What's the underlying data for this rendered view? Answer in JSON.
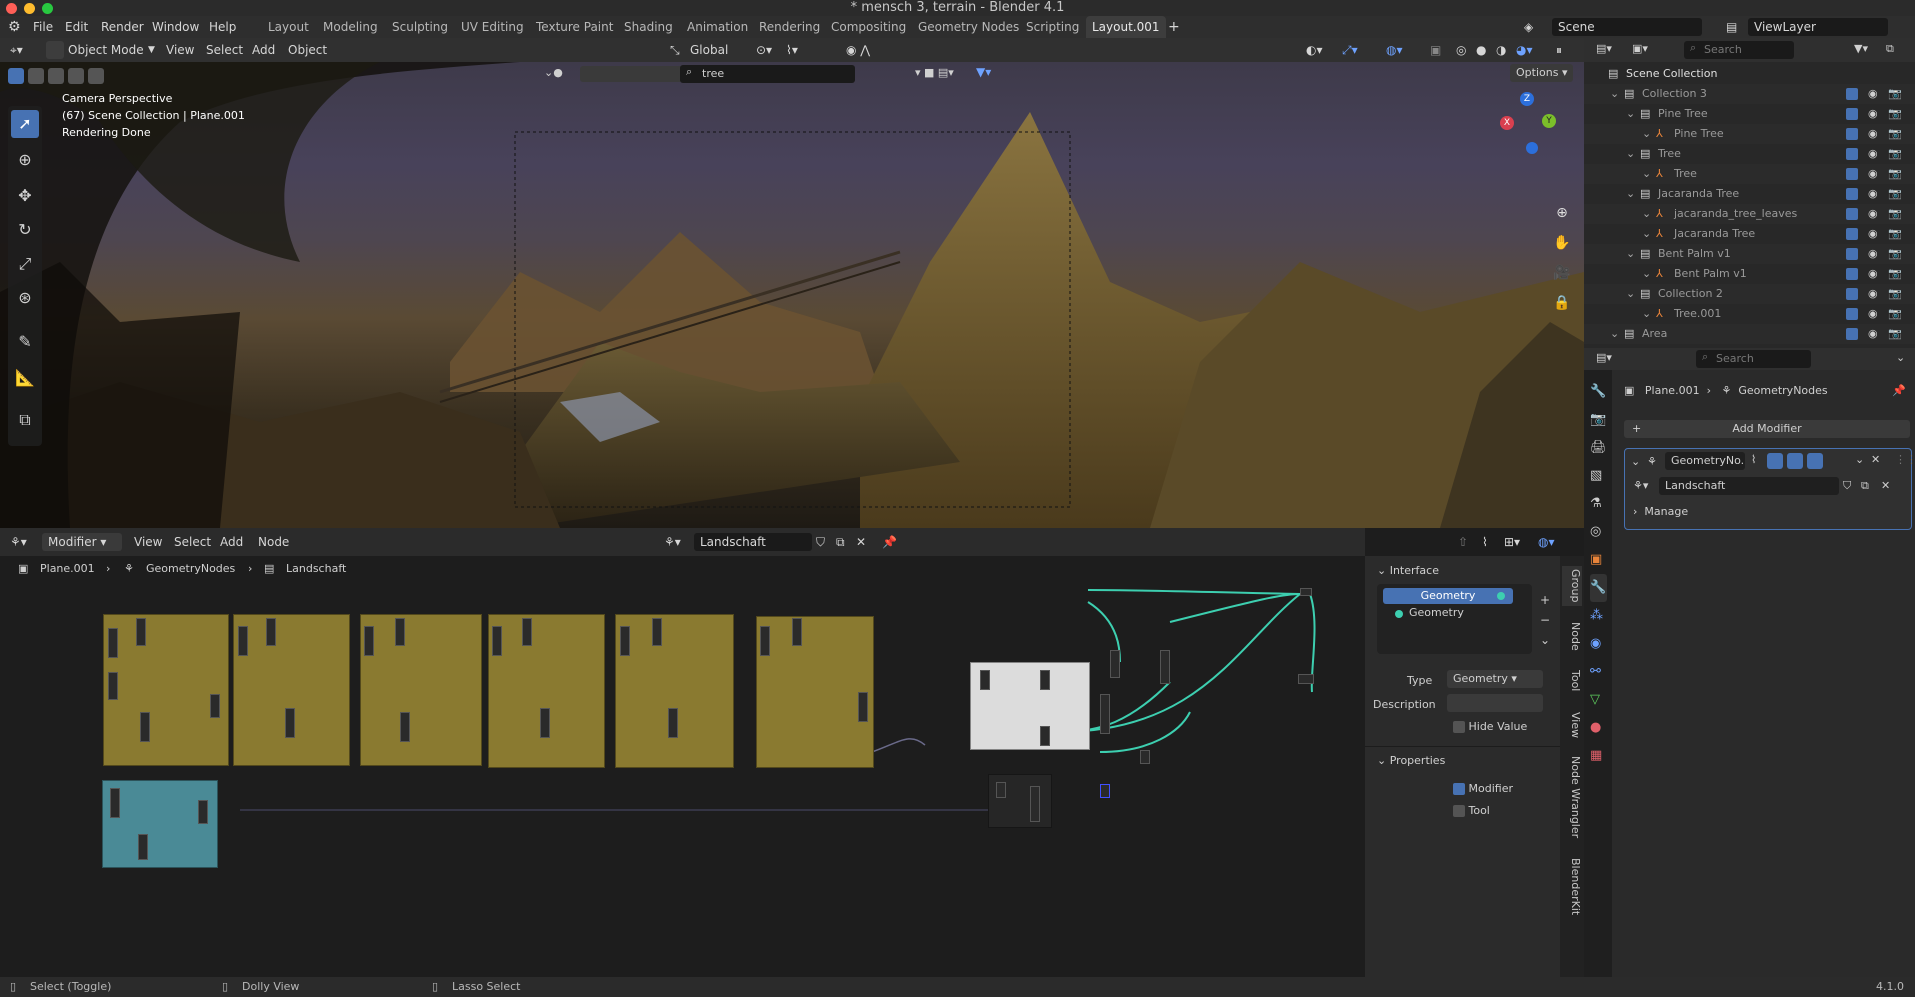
{
  "window": {
    "title": "* mensch 3, terrain - Blender 4.1"
  },
  "menu": {
    "file": "File",
    "edit": "Edit",
    "render": "Render",
    "window": "Window",
    "help": "Help"
  },
  "workspaces": [
    "Layout",
    "Modeling",
    "Sculpting",
    "UV Editing",
    "Texture Paint",
    "Shading",
    "Animation",
    "Rendering",
    "Compositing",
    "Geometry Nodes",
    "Scripting",
    "Layout.001"
  ],
  "scene": {
    "label": "Scene",
    "viewlayer": "ViewLayer"
  },
  "viewport_header": {
    "mode": "Object Mode",
    "view": "View",
    "select": "Select",
    "add": "Add",
    "object": "Object",
    "transform": "Global",
    "search_value": "tree",
    "options": "Options"
  },
  "viewport_overlay": {
    "line1": "Camera Perspective",
    "line2": "(67) Scene Collection | Plane.001",
    "line3": "Rendering Done"
  },
  "gizmo": {
    "x": "X",
    "y": "Y",
    "z": "Z"
  },
  "node_header": {
    "editor": "Modifier",
    "view": "View",
    "select": "Select",
    "add": "Add",
    "node": "Node",
    "tree_name": "Landschaft"
  },
  "breadcrumb": {
    "object": "Plane.001",
    "modifier": "GeometryNodes",
    "tree": "Landschaft"
  },
  "npanel": {
    "interface_title": "Interface",
    "sockets": [
      "Geometry",
      "Geometry"
    ],
    "type_label": "Type",
    "type_value": "Geometry",
    "description_label": "Description",
    "hide_value": "Hide Value",
    "properties_title": "Properties",
    "modifier": "Modifier",
    "tool": "Tool"
  },
  "ntabs": [
    "Group",
    "Node",
    "Tool",
    "View",
    "Node Wrangler",
    "BlenderKit"
  ],
  "outliner": {
    "search_placeholder": "Search",
    "rows": [
      {
        "label": "Scene Collection",
        "indent": 0
      },
      {
        "label": "Collection 3",
        "indent": 1
      },
      {
        "label": "Pine Tree",
        "indent": 2
      },
      {
        "label": "Pine Tree",
        "indent": 3
      },
      {
        "label": "Tree",
        "indent": 2
      },
      {
        "label": "Tree",
        "indent": 3
      },
      {
        "label": "Jacaranda Tree",
        "indent": 2
      },
      {
        "label": "jacaranda_tree_leaves",
        "indent": 3
      },
      {
        "label": "Jacaranda Tree",
        "indent": 3
      },
      {
        "label": "Bent Palm v1",
        "indent": 2
      },
      {
        "label": "Bent Palm v1",
        "indent": 3
      },
      {
        "label": "Collection 2",
        "indent": 2
      },
      {
        "label": "Tree.001",
        "indent": 3
      },
      {
        "label": "Area",
        "indent": 1
      }
    ]
  },
  "properties": {
    "search_placeholder": "Search",
    "object": "Plane.001",
    "modifier": "GeometryNodes",
    "add_modifier": "Add Modifier",
    "modifier_name": "GeometryNo...",
    "node_group": "Landschaft",
    "manage": "Manage"
  },
  "statusbar": {
    "select": "Select (Toggle)",
    "dolly": "Dolly View",
    "lasso": "Lasso Select",
    "version": "4.1.0"
  },
  "colors": {
    "accent": "#4772b3",
    "frame_yellow": "#8a7a30",
    "frame_teal": "#4a8a96",
    "wire": "#3dcfb0"
  }
}
